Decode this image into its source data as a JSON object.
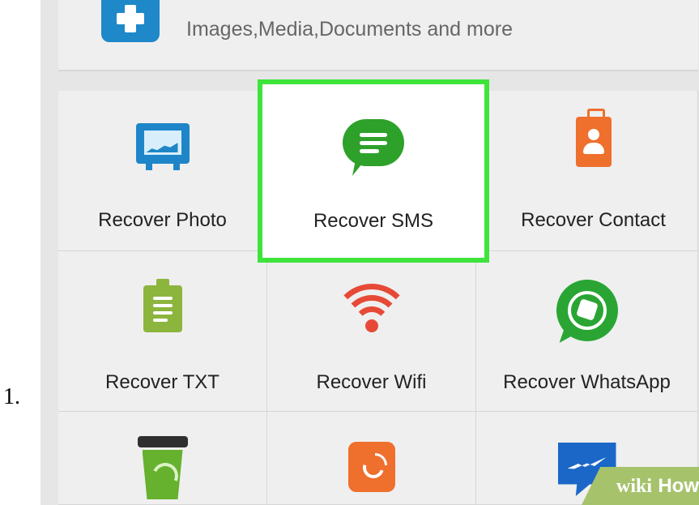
{
  "page": {
    "list_marker": "1."
  },
  "top_card": {
    "label": "Images,Media,Documents and more",
    "icon": "add-icon"
  },
  "tiles": [
    {
      "label": "Recover Photo",
      "icon": "photo-icon",
      "selected": false
    },
    {
      "label": "Recover SMS",
      "icon": "message-icon",
      "selected": true
    },
    {
      "label": "Recover Contact",
      "icon": "contact-card-icon",
      "selected": false
    },
    {
      "label": "Recover TXT",
      "icon": "clipboard-icon",
      "selected": false
    },
    {
      "label": "Recover Wifi",
      "icon": "wifi-icon",
      "selected": false
    },
    {
      "label": "Recover WhatsApp",
      "icon": "whatsapp-icon",
      "selected": false
    },
    {
      "label": "",
      "icon": "recycle-bin-icon",
      "selected": false
    },
    {
      "label": "",
      "icon": "call-log-icon",
      "selected": false
    },
    {
      "label": "",
      "icon": "messenger-icon",
      "selected": false
    }
  ],
  "watermark": {
    "wiki": "wiki",
    "how": "How"
  },
  "colors": {
    "highlight": "#3ee43c",
    "blue": "#1e88c9",
    "green": "#2ea12b",
    "orange": "#ef6f2d",
    "txt_green": "#8cb53e",
    "wifi_red": "#e64a37"
  }
}
